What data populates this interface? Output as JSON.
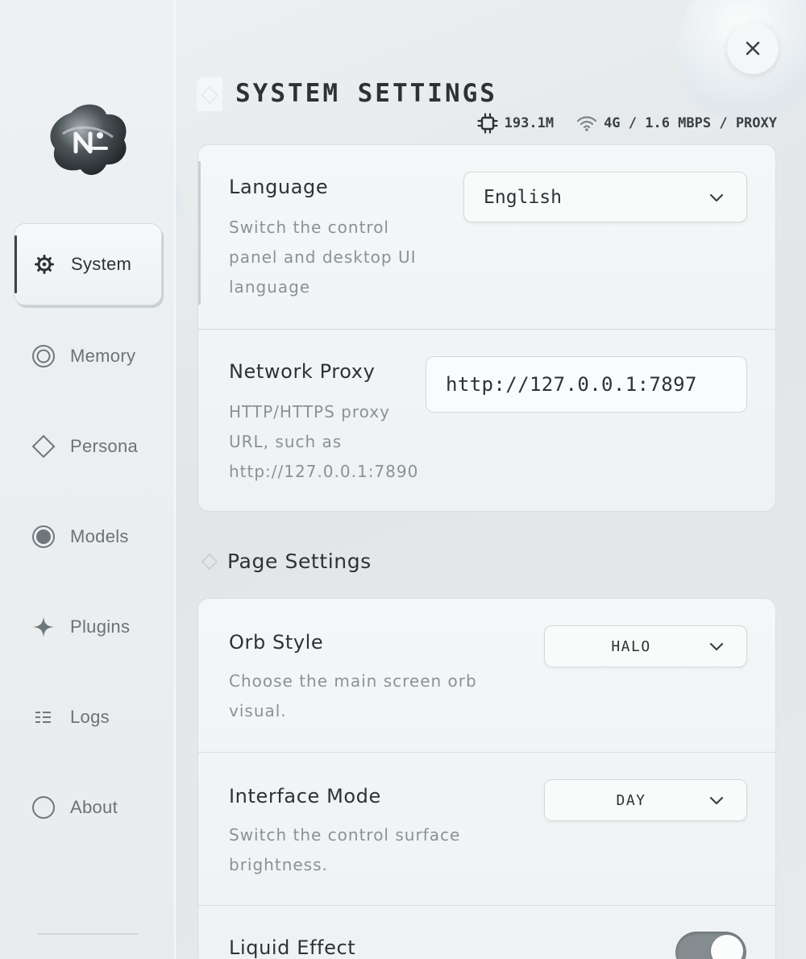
{
  "sidebar": {
    "items": [
      {
        "label": "System",
        "icon": "gear-icon",
        "active": true
      },
      {
        "label": "Memory",
        "icon": "memory-ring-icon",
        "active": false
      },
      {
        "label": "Persona",
        "icon": "diamond-icon",
        "active": false
      },
      {
        "label": "Models",
        "icon": "filled-circle-icon",
        "active": false
      },
      {
        "label": "Plugins",
        "icon": "sparkle-icon",
        "active": false
      },
      {
        "label": "Logs",
        "icon": "list-icon",
        "active": false
      },
      {
        "label": "About",
        "icon": "circle-icon",
        "active": false
      }
    ]
  },
  "header": {
    "title": "SYSTEM SETTINGS",
    "memory_usage": "193.1M",
    "network_status": "4G / 1.6 MBPS / PROXY"
  },
  "system_card": {
    "language": {
      "title": "Language",
      "desc_lines": [
        "Switch the control",
        "panel and desktop UI",
        "language"
      ],
      "value": "English"
    },
    "proxy": {
      "title": "Network Proxy",
      "desc_lines": [
        "HTTP/HTTPS proxy",
        "URL, such as",
        "http://127.0.0.1:7890"
      ],
      "value": "http://127.0.0.1:7897"
    }
  },
  "page_settings": {
    "section_label": "Page Settings",
    "orb_style": {
      "title": "Orb Style",
      "desc_lines": [
        "Choose the main screen orb",
        "visual."
      ],
      "value": "HALO"
    },
    "interface_mode": {
      "title": "Interface Mode",
      "desc_lines": [
        "Switch the control surface",
        "brightness."
      ],
      "value": "DAY"
    },
    "liquid_effect": {
      "title": "Liquid Effect",
      "enabled": true
    }
  },
  "colors": {
    "accent_dark": "#2c3236",
    "muted_text": "#8a9296",
    "toggle_on": "#858d91"
  }
}
